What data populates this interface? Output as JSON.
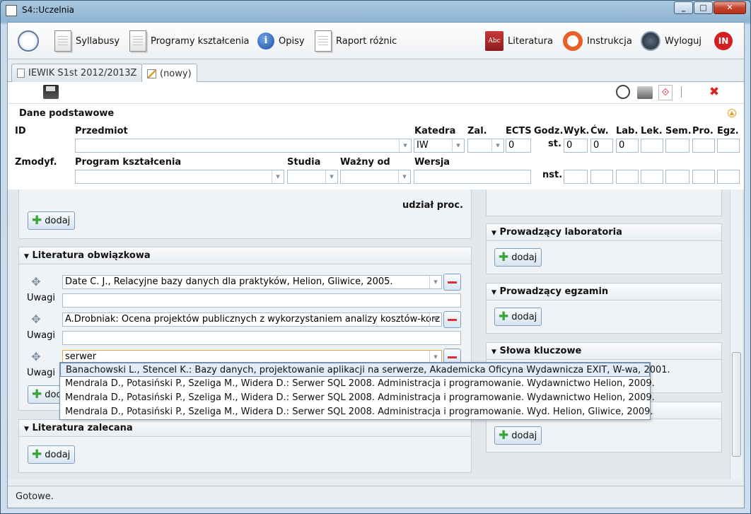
{
  "window": {
    "title": "S4::Uczelnia",
    "minimize": "_",
    "maximize": "□",
    "close": "✕"
  },
  "toolbar": {
    "syllabusy": "Syllabusy",
    "programy": "Programy kształcenia",
    "opisy": "Opisy",
    "raport": "Raport różnic",
    "literatura": "Literatura",
    "instrukcja": "Instrukcja",
    "wyloguj": "Wyloguj",
    "in_logo": "IN"
  },
  "tabs": [
    {
      "label": "IEWIK S1st 2012/2013Z"
    },
    {
      "label": "(nowy)"
    }
  ],
  "form": {
    "section_title": "Dane podstawowe",
    "labels": {
      "id": "ID",
      "przedmiot": "Przedmiot",
      "katedra": "Katedra",
      "zal": "Zal.",
      "ects": "ECTS",
      "godz": "Godz.",
      "st": "st.",
      "wyk": "Wyk.",
      "cw": "Ćw.",
      "lab": "Lab.",
      "lek": "Lek.",
      "sem": "Sem.",
      "pro": "Pro.",
      "egz": "Egz.",
      "zmodyf": "Zmodyf.",
      "program": "Program kształcenia",
      "studia": "Studia",
      "wazny": "Ważny od",
      "wersja": "Wersja",
      "nst": "nst."
    },
    "values": {
      "katedra": "IW",
      "ects": "0",
      "wyk": "0",
      "cw": "0",
      "lab": "0"
    }
  },
  "left": {
    "udzial": "udział proc.",
    "add_label": "dodaj",
    "lit_obow_title": "Literatura obwiązkowa",
    "uwagi": "Uwagi",
    "lit_entries": [
      "Date C. J., Relacyjne bazy danych dla praktyków, Helion, Gliwice, 2005.",
      "A.Drobniak: Ocena projektów publicznych z wykorzystaniem analizy kosztów-korz",
      "serwer"
    ],
    "lit_zal_title": "Literatura zalecana"
  },
  "right": {
    "prow_lab": "Prowadzący laboratoria",
    "prow_egz": "Prowadzący egzamin",
    "slowa": "Słowa kluczowe",
    "add_label": "dodaj"
  },
  "dropdown": [
    "Banachowski L., Stencel K.: Bazy danych, projektowanie aplikacji na serwerze, Akademicka Oficyna Wydawnicza EXIT, W-wa, 2001.",
    "Mendrala D., Potasiński P., Szeliga M., Widera D.: Serwer SQL 2008. Administracja i programowanie. Wydawnictwo Helion, 2009.",
    "Mendrala D., Potasiński P., Szeliga M., Widera D.: Serwer SQL 2008. Administracja i programowanie. Wydawnictwo Helion, 2009.",
    "Mendrala D., Potasiński P., Szeliga M., Widera D.: Serwer SQL 2008. Administracja i programowanie. Wyd. Helion, Gliwice, 2009."
  ],
  "status": "Gotowe."
}
